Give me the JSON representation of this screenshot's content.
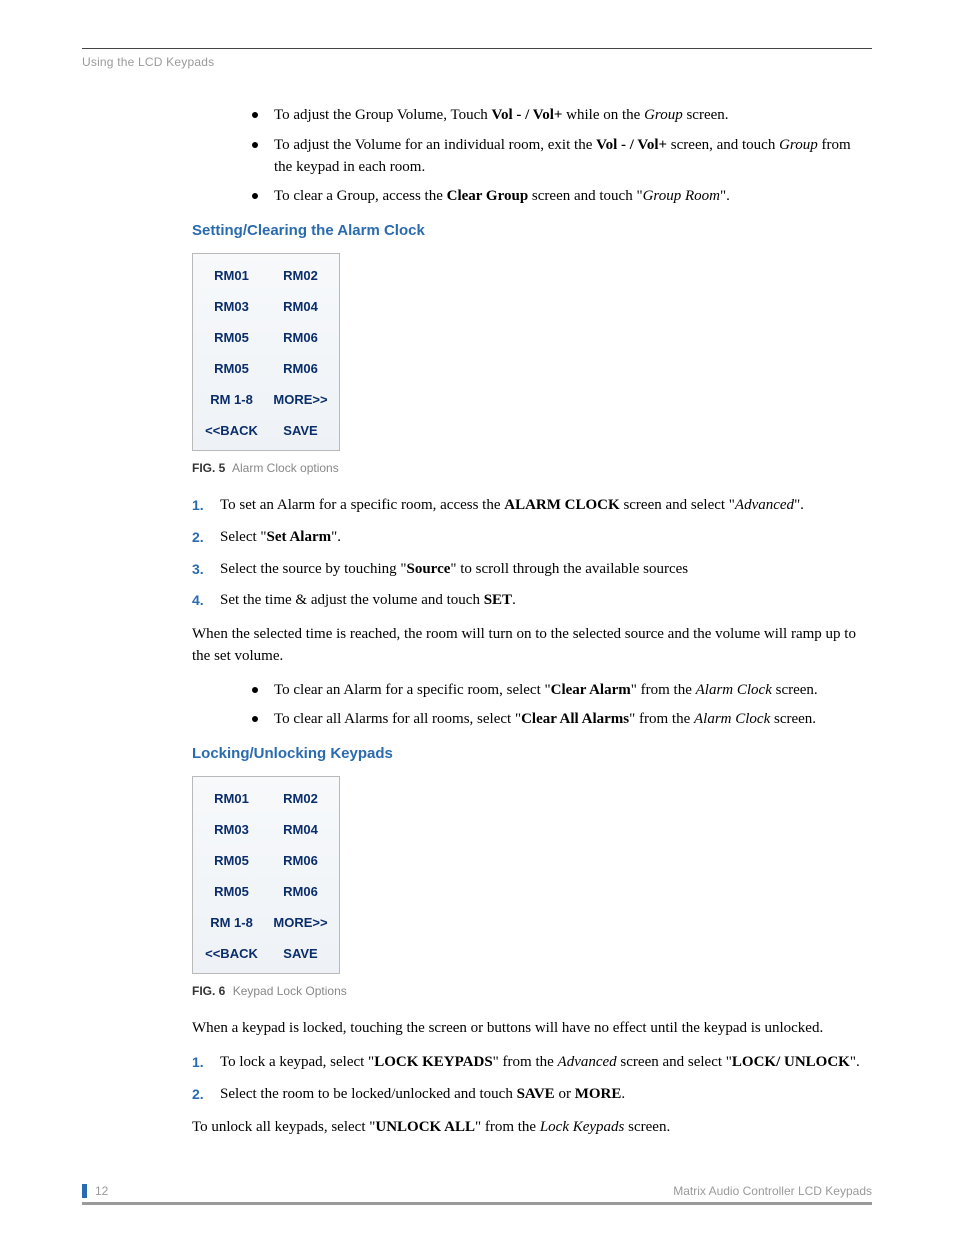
{
  "running_head": "Using the LCD Keypads",
  "bullets_top": [
    {
      "pre": "To adjust the Group Volume, Touch ",
      "b1": "Vol - / Vol+",
      "mid": " while on the ",
      "i1": "Group",
      "post": " screen."
    },
    {
      "pre": "To adjust the Volume for an individual room, exit the ",
      "i1": "Group",
      "mid": " screen, and touch ",
      "b1": "Vol - / Vol+",
      "post": " from the keypad in each room."
    },
    {
      "pre": "To clear a Group, access the ",
      "i1": "Group Room",
      "mid": " screen and touch \"",
      "b1": "Clear Group",
      "post": "\"."
    }
  ],
  "section1_head": "Setting/Clearing the Alarm Clock",
  "lcd1": [
    [
      "RM01",
      "RM02"
    ],
    [
      "RM03",
      "RM04"
    ],
    [
      "RM05",
      "RM06"
    ],
    [
      "RM05",
      "RM06"
    ],
    [
      "RM 1-8",
      "MORE>>"
    ],
    [
      "<<BACK",
      "SAVE"
    ]
  ],
  "fig1_label": "FIG. 5",
  "fig1_text": "Alarm Clock options",
  "steps1": [
    {
      "pre": "To set an Alarm for a specific room, access the ",
      "i1": "Advanced",
      "mid": " screen and select \"",
      "b1": "ALARM CLOCK",
      "post": "\"."
    },
    {
      "pre": "Select \"",
      "b1": "Set Alarm",
      "post": "\"."
    },
    {
      "pre": "Select the source by touching \"",
      "b1": "Source",
      "post": "\" to scroll through the available sources"
    },
    {
      "pre": "Set the time & adjust the volume and touch ",
      "b1": "SET",
      "post": "."
    }
  ],
  "para1": "When the selected time is reached, the room will turn on to the selected source and the volume will ramp up to the set volume.",
  "bullets_mid": [
    {
      "pre": "To clear an Alarm for a specific room, select \"",
      "b1": "Clear Alarm",
      "mid": "\" from the ",
      "i1": "Alarm Clock",
      "post": " screen."
    },
    {
      "pre": "To clear all Alarms for all rooms, select \"",
      "b1": "Clear All Alarms",
      "mid": "\" from the ",
      "i1": "Alarm Clock",
      "post": " screen."
    }
  ],
  "section2_head": "Locking/Unlocking Keypads",
  "lcd2": [
    [
      "RM01",
      "RM02"
    ],
    [
      "RM03",
      "RM04"
    ],
    [
      "RM05",
      "RM06"
    ],
    [
      "RM05",
      "RM06"
    ],
    [
      "RM 1-8",
      "MORE>>"
    ],
    [
      "<<BACK",
      "SAVE"
    ]
  ],
  "fig2_label": "FIG. 6",
  "fig2_text": "Keypad Lock Options",
  "para2": "When a keypad is locked, touching the screen or buttons will have no effect until the keypad is unlocked.",
  "steps2": [
    {
      "pre": "To lock a keypad, select \"",
      "b1": "LOCK KEYPADS",
      "mid": "\" from the ",
      "i1": "Advanced",
      "mid2": " screen and select \"",
      "b2": "LOCK/ UNLOCK",
      "post": "\"."
    },
    {
      "pre": "Select the room to be locked/unlocked and touch ",
      "b1": "SAVE",
      "mid": " or ",
      "b2": "MORE",
      "post": "."
    }
  ],
  "para3_pre": "To unlock all keypads, select \"",
  "para3_b": "UNLOCK ALL",
  "para3_mid": "\" from the ",
  "para3_i": "Lock Keypads",
  "para3_post": " screen.",
  "page_number": "12",
  "footer_right": "Matrix Audio Controller LCD Keypads"
}
